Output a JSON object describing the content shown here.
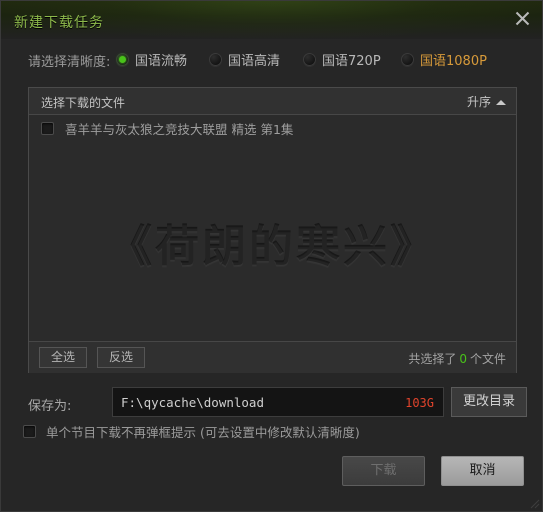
{
  "titlebar": {
    "title": "新建下载任务",
    "close_icon": "close-icon"
  },
  "quality": {
    "label": "请选择清晰度:",
    "options": [
      {
        "label": "国语流畅",
        "selected": true,
        "accent": false
      },
      {
        "label": "国语高清",
        "selected": false,
        "accent": false
      },
      {
        "label": "国语720P",
        "selected": false,
        "accent": false
      },
      {
        "label": "国语1080P",
        "selected": false,
        "accent": true
      }
    ],
    "accent_color": "#d79a3a",
    "selected_dot_color": "#49c21a"
  },
  "file_list": {
    "header_title": "选择下载的文件",
    "sort_label": "升序",
    "sort_direction": "asc",
    "watermark_text": "《荷朗的寒兴》",
    "rows": [
      {
        "name": "喜羊羊与灰太狼之竞技大联盟 精选 第1集",
        "checked": false
      }
    ],
    "footer": {
      "select_all_label": "全选",
      "invert_label": "反选",
      "count_prefix": "共选择了",
      "count_value": "0",
      "count_suffix": "个文件",
      "count_color": "#49c21a"
    }
  },
  "save_path": {
    "label": "保存为:",
    "value": "F:\\qycache\\download",
    "free_space": "103G",
    "free_space_color": "#e1442c",
    "change_dir_label": "更改目录"
  },
  "remember": {
    "label": "单个节目下载不再弹框提示 (可去设置中修改默认清晰度)",
    "checked": false
  },
  "actions": {
    "download_label": "下载",
    "download_enabled": false,
    "cancel_label": "取消"
  }
}
